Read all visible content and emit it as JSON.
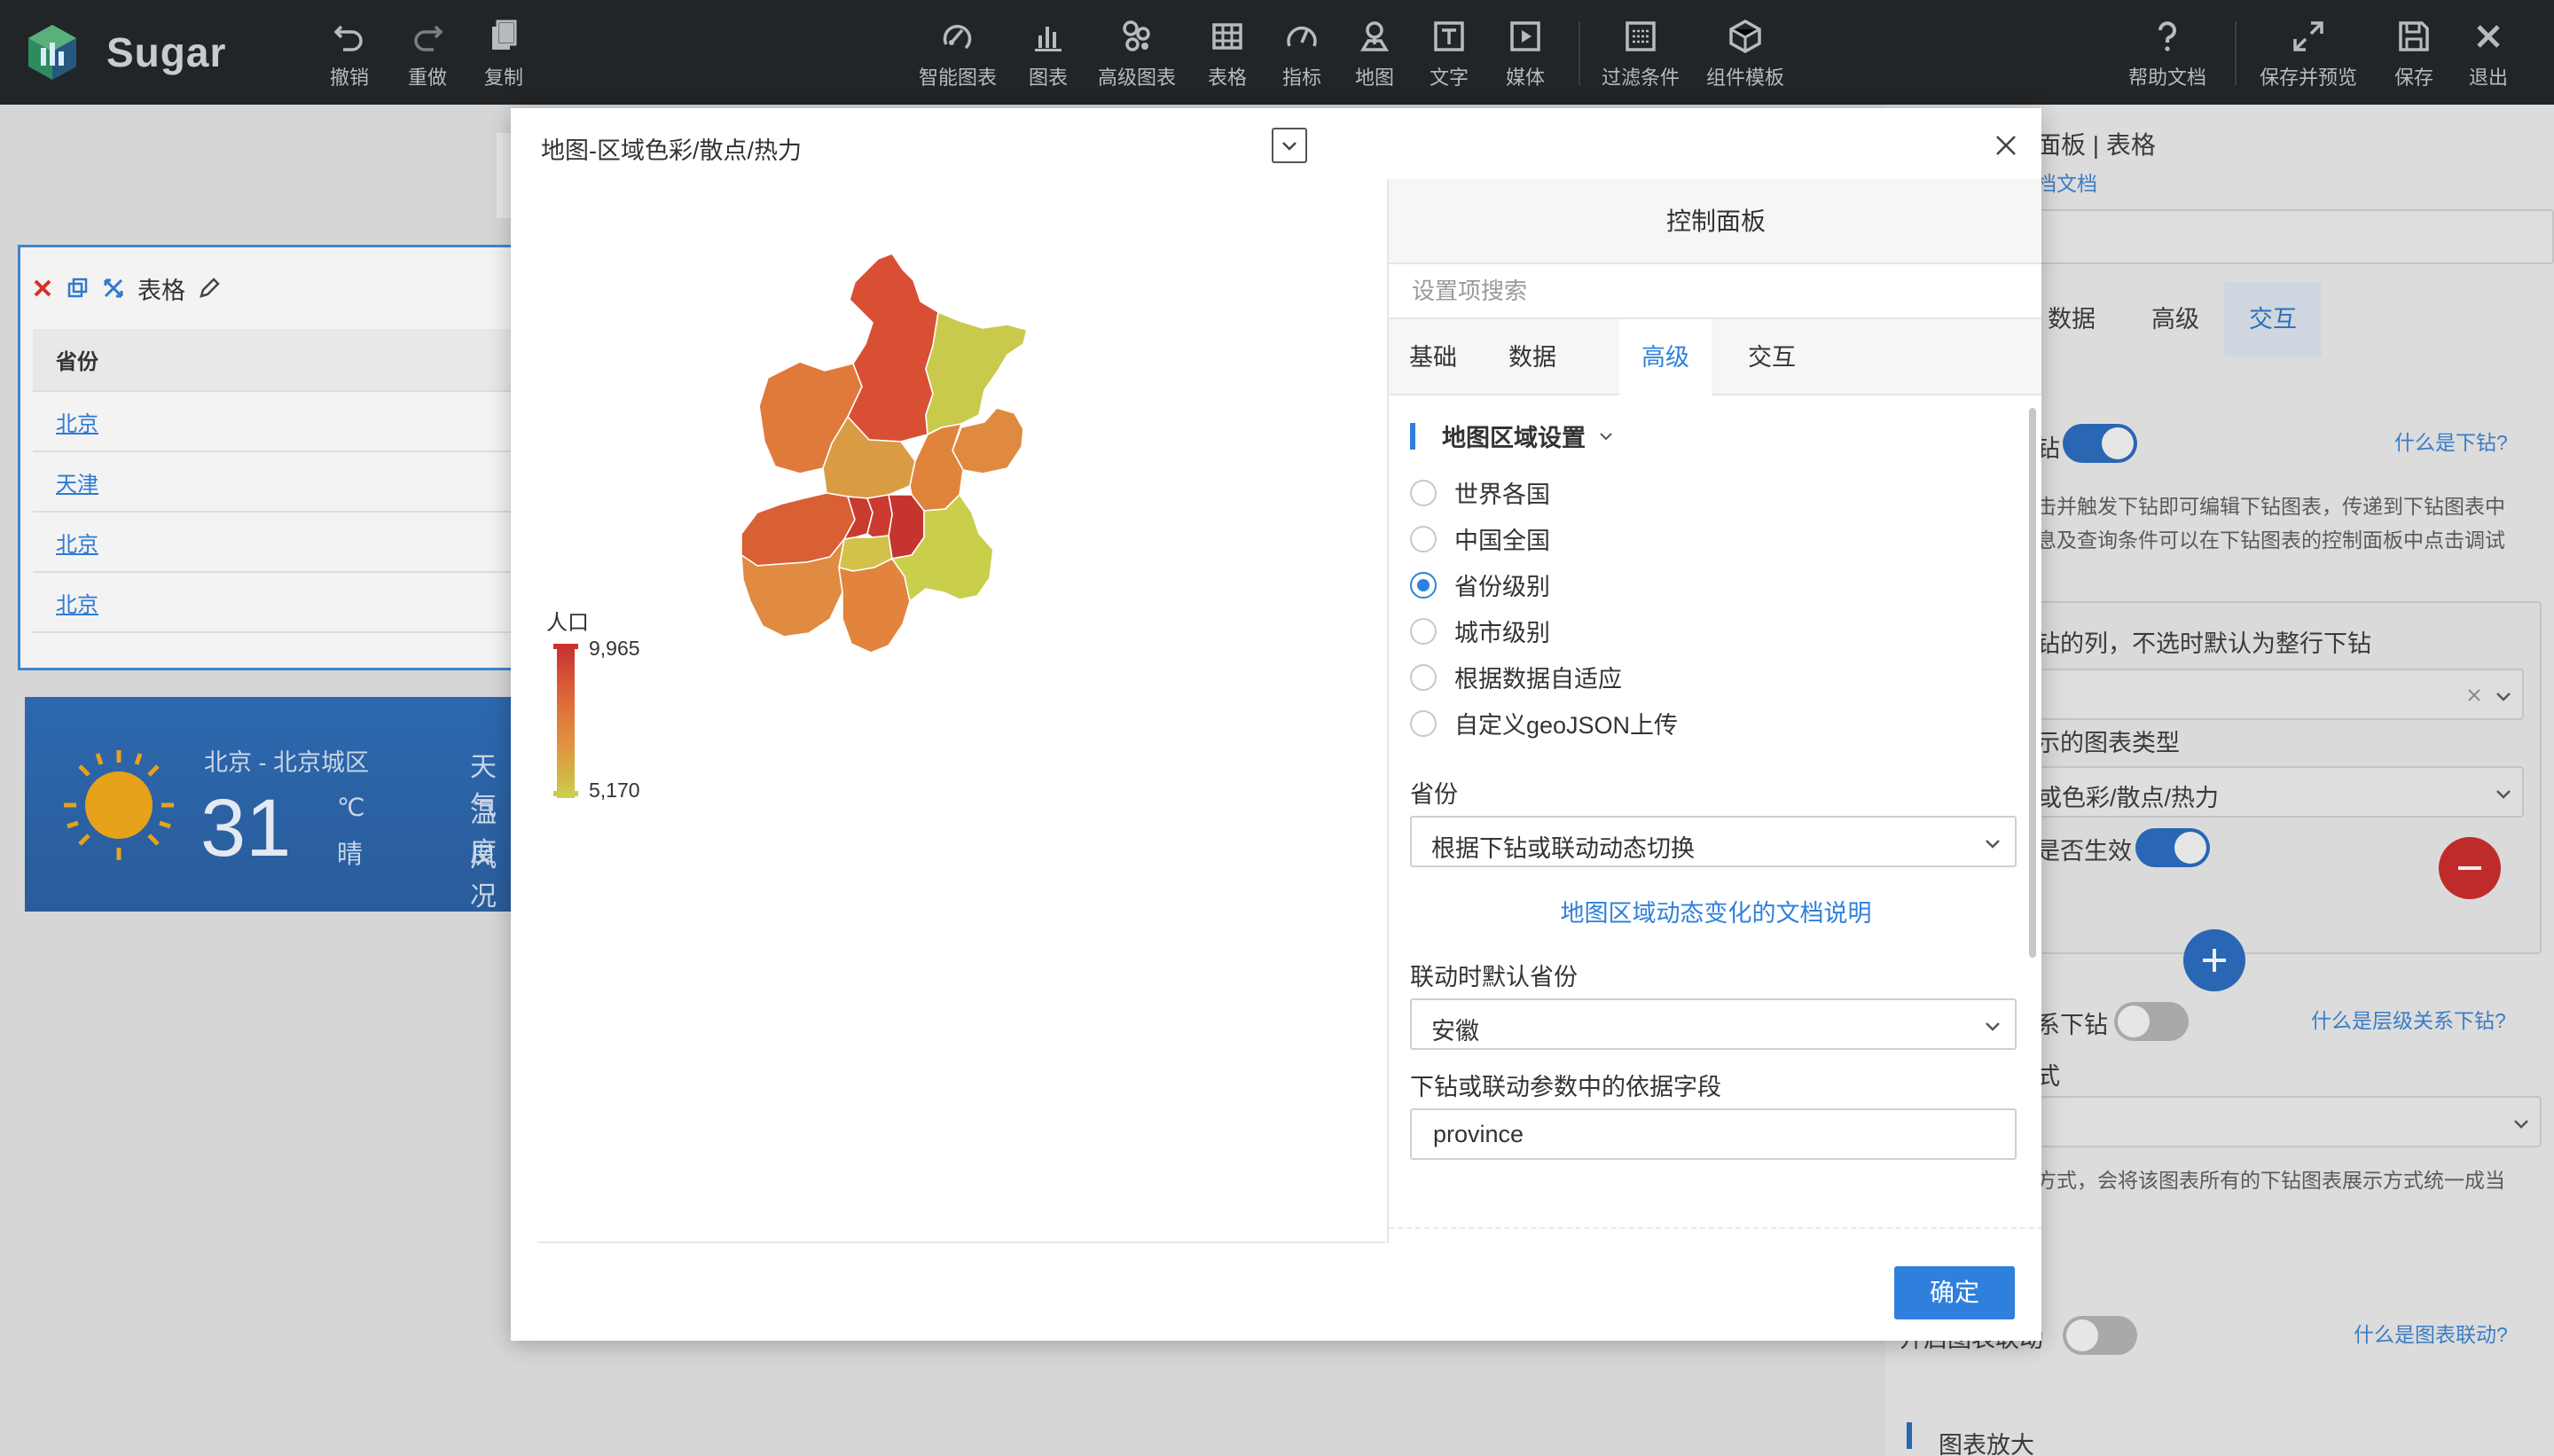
{
  "app": {
    "name": "Sugar"
  },
  "toolbar": {
    "left": [
      {
        "label": "撤销",
        "icon": "undo-icon"
      },
      {
        "label": "重做",
        "icon": "redo-icon"
      },
      {
        "label": "复制",
        "icon": "copy-icon"
      }
    ],
    "center": [
      {
        "label": "智能图表",
        "icon": "smart-chart-icon"
      },
      {
        "label": "图表",
        "icon": "bar-chart-icon"
      },
      {
        "label": "高级图表",
        "icon": "advanced-chart-icon"
      },
      {
        "label": "表格",
        "icon": "table-icon"
      },
      {
        "label": "指标",
        "icon": "gauge-icon"
      },
      {
        "label": "地图",
        "icon": "map-pin-icon"
      },
      {
        "label": "文字",
        "icon": "text-icon"
      },
      {
        "label": "媒体",
        "icon": "media-icon"
      },
      {
        "label": "过滤条件",
        "icon": "filter-icon"
      },
      {
        "label": "组件模板",
        "icon": "template-icon"
      }
    ],
    "right": [
      {
        "label": "帮助文档",
        "icon": "help-icon"
      },
      {
        "label": "保存并预览",
        "icon": "expand-icon"
      },
      {
        "label": "保存",
        "icon": "save-icon"
      },
      {
        "label": "退出",
        "icon": "close-icon"
      }
    ]
  },
  "canvas": {
    "table_widget": {
      "title": "表格",
      "column": "省份",
      "rows": [
        "北京",
        "天津",
        "北京",
        "北京"
      ]
    },
    "weather": {
      "city": "北京 - 北京城区",
      "temperature": "31",
      "unit": "℃",
      "condition": "晴",
      "side_labels": [
        "天气",
        "温度",
        "风况"
      ]
    }
  },
  "right_panel": {
    "title": "面板 | 表格",
    "doc_link": "档文档",
    "tabs": [
      "数据",
      "高级",
      "交互"
    ],
    "active_tab": "交互",
    "drill_label": "钻",
    "drill_help": "什么是下钻?",
    "drill_desc_1": "击并触发下钻即可编辑下钻图表，传递到下钻图表中",
    "drill_desc_2": "息及查询条件可以在下钻图表的控制面板中点击调试",
    "drill_column_label": "钻的列，不选时默认为整行下钻",
    "chart_type_label": "示的图表类型",
    "chart_type_value": "或色彩/散点/热力",
    "effective_label": "是否生效",
    "level_drill_label": "系下钻",
    "level_drill_help": "什么是层级关系下钻?",
    "mode_label": "式",
    "mode_desc": "方式，会将该图表所有的下钻图表展示方式统一成当",
    "link_label": "开启图表联动",
    "link_help": "什么是图表联动?",
    "zoom_label": "图表放大"
  },
  "modal": {
    "title": "地图-区域色彩/散点/热力",
    "legend": {
      "title": "人口",
      "max": "9,965",
      "min": "5,170"
    },
    "control_panel": {
      "title": "控制面板",
      "search_placeholder": "设置项搜索",
      "tabs": [
        "基础",
        "数据",
        "高级",
        "交互"
      ],
      "active_tab": "高级",
      "section_title": "地图区域设置",
      "region_options": [
        "世界各国",
        "中国全国",
        "省份级别",
        "城市级别",
        "根据数据自适应",
        "自定义geoJSON上传"
      ],
      "selected_region": "省份级别",
      "province_label": "省份",
      "province_value": "根据下钻或联动动态切换",
      "doc_link": "地图区域动态变化的文档说明",
      "default_province_label": "联动时默认省份",
      "default_province_value": "安徽",
      "field_label": "下钻或联动参数中的依据字段",
      "field_value": "province"
    },
    "ok_label": "确定"
  },
  "colors": {
    "toolbar_bg": "#222527",
    "accent": "#2f80dd",
    "map_high": "#c83230",
    "map_mid": "#e2933f",
    "map_low": "#c9cf4a"
  }
}
